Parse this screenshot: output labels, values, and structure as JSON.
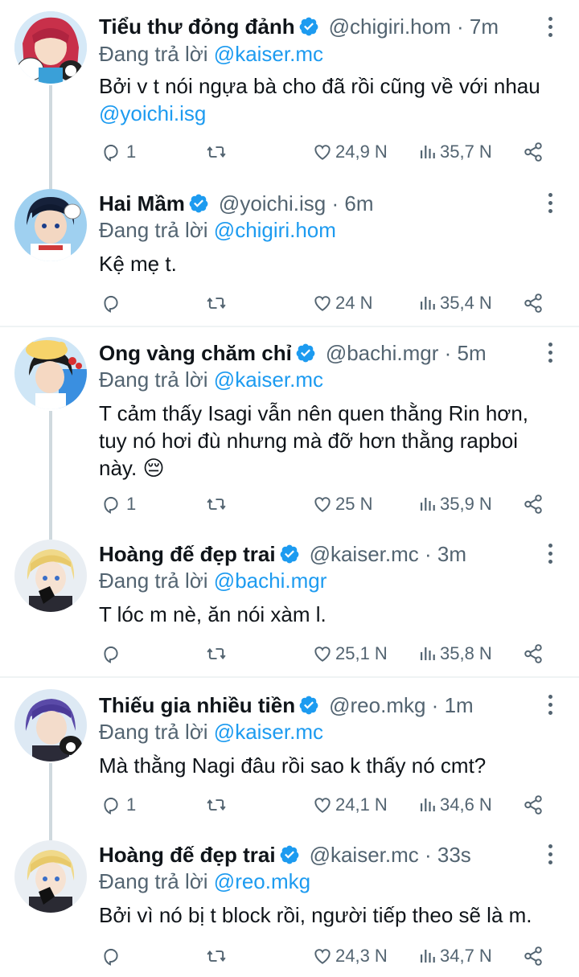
{
  "labels": {
    "replying_to": "Đang trả lời"
  },
  "colors": {
    "accent": "#1d9bf0",
    "muted": "#536471",
    "text": "#0f1419",
    "thread_line": "#cfd9de"
  },
  "tweets": [
    {
      "name": "Tiểu thư đỏng đảnh",
      "handle": "@chigiri.hom",
      "time": "7m",
      "reply_to": "@kaiser.mc",
      "text": "Bởi v t nói ngựa bà cho đã rồi cũng về với nhau",
      "text_mention": "@yoichi.isg",
      "replies": "1",
      "likes": "24,9 N",
      "views": "35,7 N",
      "avatar_theme": "pink-hair-with-plush"
    },
    {
      "name": "Hai Mầm",
      "handle": "@yoichi.isg",
      "time": "6m",
      "reply_to": "@chigiri.hom",
      "text": "Kệ mẹ t.",
      "replies": "",
      "likes": "24 N",
      "views": "35,4 N",
      "avatar_theme": "dark-hair-blue"
    },
    {
      "name": "Ong vàng chăm chỉ",
      "handle": "@bachi.mgr",
      "time": "5m",
      "reply_to": "@kaiser.mc",
      "text": "T cảm thấy Isagi vẫn nên quen thằng Rin hơn, tuy nó hơi đù nhưng mà đỡ hơn thằng rapboi này. 😔",
      "replies": "1",
      "likes": "25 N",
      "views": "35,9 N",
      "avatar_theme": "dark-hair-yellow-hat"
    },
    {
      "name": "Hoàng đế đẹp trai",
      "handle": "@kaiser.mc",
      "time": "3m",
      "reply_to": "@bachi.mgr",
      "text": "T lóc m nè, ăn nói xàm l.",
      "replies": "",
      "likes": "25,1 N",
      "views": "35,8 N",
      "avatar_theme": "blonde-black-glove"
    },
    {
      "name": "Thiếu gia nhiều tiền",
      "handle": "@reo.mkg",
      "time": "1m",
      "reply_to": "@kaiser.mc",
      "text": "Mà thằng Nagi đâu rồi sao k thấy nó cmt?",
      "replies": "1",
      "likes": "24,1 N",
      "views": "34,6 N",
      "avatar_theme": "purple-hair-plush"
    },
    {
      "name": "Hoàng đế đẹp trai",
      "handle": "@kaiser.mc",
      "time": "33s",
      "reply_to": "@reo.mkg",
      "text": "Bởi vì nó bị t block rồi, người tiếp theo sẽ là m.",
      "replies": "",
      "likes": "24,3 N",
      "views": "34,7 N",
      "avatar_theme": "blonde-black-glove"
    }
  ]
}
